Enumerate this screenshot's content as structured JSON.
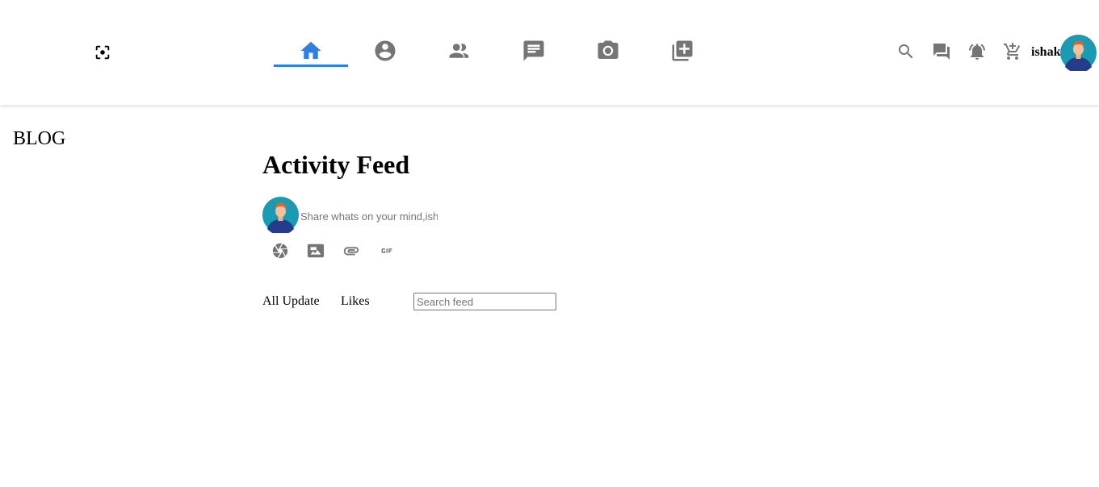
{
  "header": {
    "logo_icon": "center-focus-icon",
    "nav": [
      {
        "name": "home-icon",
        "active": true
      },
      {
        "name": "account-circle-icon",
        "active": false
      },
      {
        "name": "people-icon",
        "active": false
      },
      {
        "name": "chat-icon",
        "active": false
      },
      {
        "name": "camera-icon",
        "active": false
      },
      {
        "name": "add-box-icon",
        "active": false
      }
    ],
    "actions": [
      "search-icon",
      "forum-icon",
      "notifications-icon",
      "add-shopping-cart-icon"
    ],
    "username": "ishak",
    "accent_color": "#2f7ee0",
    "icon_color": "#757575"
  },
  "sidebar": {
    "title": "BLOG"
  },
  "main": {
    "title": "Activity Feed",
    "post": {
      "placeholder": "Share whats on your mind,ishak",
      "tools": [
        "camera-aperture-icon",
        "image-icon",
        "attachment-icon",
        "gif-icon"
      ]
    },
    "tabs": [
      {
        "label": "All Update"
      },
      {
        "label": "Likes"
      }
    ],
    "search": {
      "placeholder": "Search feed"
    }
  }
}
